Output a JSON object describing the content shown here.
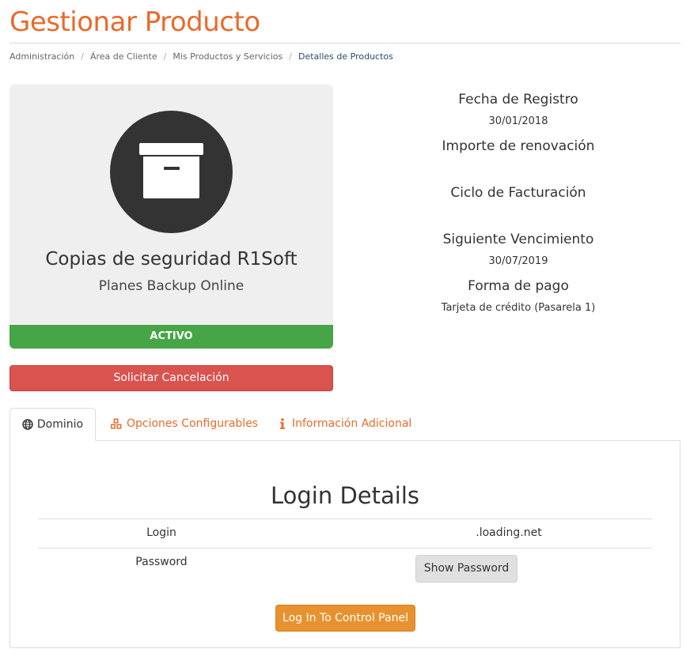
{
  "header": {
    "title": "Gestionar Producto"
  },
  "breadcrumb": [
    "Administración",
    "Área de Cliente",
    "Mis Productos y Servicios",
    "Detalles de Productos"
  ],
  "product": {
    "name": "Copias de seguridad R1Soft",
    "group": "Planes Backup Online",
    "status": "ACTIVO",
    "icon": "archive-box-icon"
  },
  "actions": {
    "cancel_label": "Solicitar Cancelación"
  },
  "info": {
    "registration_label": "Fecha de Registro",
    "registration_value": "30/01/2018",
    "renewal_label": "Importe de renovación",
    "renewal_value": "",
    "cycle_label": "Ciclo de Facturación",
    "cycle_value": "",
    "next_due_label": "Siguiente Vencimiento",
    "next_due_value": "30/07/2019",
    "payment_label": "Forma de pago",
    "payment_value": "Tarjeta de crédito (Pasarela 1)"
  },
  "tabs": [
    {
      "label": "Dominio",
      "icon": "globe-icon"
    },
    {
      "label": "Opciones Configurables",
      "icon": "cubes-icon"
    },
    {
      "label": "Información Adicional",
      "icon": "info-icon"
    }
  ],
  "login": {
    "heading": "Login Details",
    "login_label": "Login",
    "login_value": ".loading.net",
    "password_label": "Password",
    "show_password_label": "Show Password",
    "control_panel_label": "Log In To Control Panel"
  },
  "colors": {
    "accent": "#ea6a2a",
    "active": "#46a546",
    "danger": "#d9534f",
    "cta": "#e8922f"
  }
}
